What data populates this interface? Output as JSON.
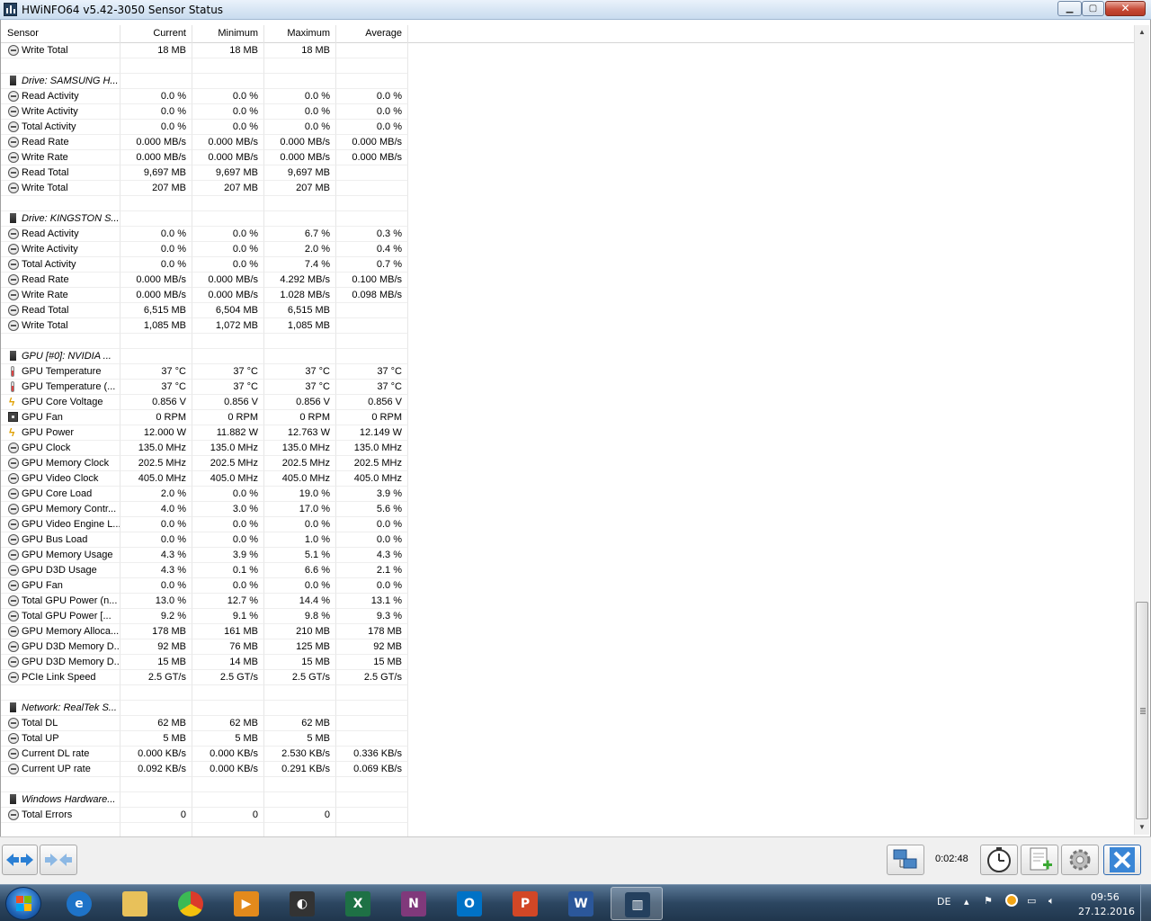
{
  "window": {
    "title": "HWiNFO64 v5.42-3050 Sensor Status",
    "controls": {
      "minimize": "▁",
      "maximize": "▢",
      "close": "✕"
    }
  },
  "table": {
    "headers": [
      "Sensor",
      "Current",
      "Minimum",
      "Maximum",
      "Average"
    ],
    "rows": [
      {
        "type": "item",
        "icon": "clock",
        "name": "Write Total",
        "current": "18 MB",
        "min": "18 MB",
        "max": "18 MB",
        "avg": ""
      },
      {
        "type": "blank"
      },
      {
        "type": "group",
        "icon": "drive",
        "name": "Drive: SAMSUNG H..."
      },
      {
        "type": "item",
        "icon": "clock",
        "name": "Read Activity",
        "current": "0.0 %",
        "min": "0.0 %",
        "max": "0.0 %",
        "avg": "0.0 %"
      },
      {
        "type": "item",
        "icon": "clock",
        "name": "Write Activity",
        "current": "0.0 %",
        "min": "0.0 %",
        "max": "0.0 %",
        "avg": "0.0 %"
      },
      {
        "type": "item",
        "icon": "clock",
        "name": "Total Activity",
        "current": "0.0 %",
        "min": "0.0 %",
        "max": "0.0 %",
        "avg": "0.0 %"
      },
      {
        "type": "item",
        "icon": "clock",
        "name": "Read Rate",
        "current": "0.000 MB/s",
        "min": "0.000 MB/s",
        "max": "0.000 MB/s",
        "avg": "0.000 MB/s"
      },
      {
        "type": "item",
        "icon": "clock",
        "name": "Write Rate",
        "current": "0.000 MB/s",
        "min": "0.000 MB/s",
        "max": "0.000 MB/s",
        "avg": "0.000 MB/s"
      },
      {
        "type": "item",
        "icon": "clock",
        "name": "Read Total",
        "current": "9,697 MB",
        "min": "9,697 MB",
        "max": "9,697 MB",
        "avg": ""
      },
      {
        "type": "item",
        "icon": "clock",
        "name": "Write Total",
        "current": "207 MB",
        "min": "207 MB",
        "max": "207 MB",
        "avg": ""
      },
      {
        "type": "blank"
      },
      {
        "type": "group",
        "icon": "drive",
        "name": "Drive: KINGSTON S..."
      },
      {
        "type": "item",
        "icon": "clock",
        "name": "Read Activity",
        "current": "0.0 %",
        "min": "0.0 %",
        "max": "6.7 %",
        "avg": "0.3 %"
      },
      {
        "type": "item",
        "icon": "clock",
        "name": "Write Activity",
        "current": "0.0 %",
        "min": "0.0 %",
        "max": "2.0 %",
        "avg": "0.4 %"
      },
      {
        "type": "item",
        "icon": "clock",
        "name": "Total Activity",
        "current": "0.0 %",
        "min": "0.0 %",
        "max": "7.4 %",
        "avg": "0.7 %"
      },
      {
        "type": "item",
        "icon": "clock",
        "name": "Read Rate",
        "current": "0.000 MB/s",
        "min": "0.000 MB/s",
        "max": "4.292 MB/s",
        "avg": "0.100 MB/s"
      },
      {
        "type": "item",
        "icon": "clock",
        "name": "Write Rate",
        "current": "0.000 MB/s",
        "min": "0.000 MB/s",
        "max": "1.028 MB/s",
        "avg": "0.098 MB/s"
      },
      {
        "type": "item",
        "icon": "clock",
        "name": "Read Total",
        "current": "6,515 MB",
        "min": "6,504 MB",
        "max": "6,515 MB",
        "avg": ""
      },
      {
        "type": "item",
        "icon": "clock",
        "name": "Write Total",
        "current": "1,085 MB",
        "min": "1,072 MB",
        "max": "1,085 MB",
        "avg": ""
      },
      {
        "type": "blank"
      },
      {
        "type": "group",
        "icon": "drive",
        "name": "GPU [#0]: NVIDIA ..."
      },
      {
        "type": "item",
        "icon": "therm",
        "name": "GPU Temperature",
        "current": "37 °C",
        "min": "37 °C",
        "max": "37 °C",
        "avg": "37 °C"
      },
      {
        "type": "item",
        "icon": "therm",
        "name": "GPU Temperature (...",
        "current": "37 °C",
        "min": "37 °C",
        "max": "37 °C",
        "avg": "37 °C"
      },
      {
        "type": "item",
        "icon": "bolt",
        "name": "GPU Core Voltage",
        "current": "0.856 V",
        "min": "0.856 V",
        "max": "0.856 V",
        "avg": "0.856 V"
      },
      {
        "type": "item",
        "icon": "fan",
        "name": "GPU Fan",
        "current": "0 RPM",
        "min": "0 RPM",
        "max": "0 RPM",
        "avg": "0 RPM"
      },
      {
        "type": "item",
        "icon": "bolt",
        "name": "GPU Power",
        "current": "12.000 W",
        "min": "11.882 W",
        "max": "12.763 W",
        "avg": "12.149 W"
      },
      {
        "type": "item",
        "icon": "clock",
        "name": "GPU Clock",
        "current": "135.0 MHz",
        "min": "135.0 MHz",
        "max": "135.0 MHz",
        "avg": "135.0 MHz"
      },
      {
        "type": "item",
        "icon": "clock",
        "name": "GPU Memory Clock",
        "current": "202.5 MHz",
        "min": "202.5 MHz",
        "max": "202.5 MHz",
        "avg": "202.5 MHz"
      },
      {
        "type": "item",
        "icon": "clock",
        "name": "GPU Video Clock",
        "current": "405.0 MHz",
        "min": "405.0 MHz",
        "max": "405.0 MHz",
        "avg": "405.0 MHz"
      },
      {
        "type": "item",
        "icon": "clock",
        "name": "GPU Core Load",
        "current": "2.0 %",
        "min": "0.0 %",
        "max": "19.0 %",
        "avg": "3.9 %"
      },
      {
        "type": "item",
        "icon": "clock",
        "name": "GPU Memory Contr...",
        "current": "4.0 %",
        "min": "3.0 %",
        "max": "17.0 %",
        "avg": "5.6 %"
      },
      {
        "type": "item",
        "icon": "clock",
        "name": "GPU Video Engine L...",
        "current": "0.0 %",
        "min": "0.0 %",
        "max": "0.0 %",
        "avg": "0.0 %"
      },
      {
        "type": "item",
        "icon": "clock",
        "name": "GPU Bus Load",
        "current": "0.0 %",
        "min": "0.0 %",
        "max": "1.0 %",
        "avg": "0.0 %"
      },
      {
        "type": "item",
        "icon": "clock",
        "name": "GPU Memory Usage",
        "current": "4.3 %",
        "min": "3.9 %",
        "max": "5.1 %",
        "avg": "4.3 %"
      },
      {
        "type": "item",
        "icon": "clock",
        "name": "GPU D3D Usage",
        "current": "4.3 %",
        "min": "0.1 %",
        "max": "6.6 %",
        "avg": "2.1 %"
      },
      {
        "type": "item",
        "icon": "clock",
        "name": "GPU Fan",
        "current": "0.0 %",
        "min": "0.0 %",
        "max": "0.0 %",
        "avg": "0.0 %"
      },
      {
        "type": "item",
        "icon": "clock",
        "name": "Total GPU Power (n...",
        "current": "13.0 %",
        "min": "12.7 %",
        "max": "14.4 %",
        "avg": "13.1 %"
      },
      {
        "type": "item",
        "icon": "clock",
        "name": "Total GPU Power [...",
        "current": "9.2 %",
        "min": "9.1 %",
        "max": "9.8 %",
        "avg": "9.3 %"
      },
      {
        "type": "item",
        "icon": "clock",
        "name": "GPU Memory Alloca...",
        "current": "178 MB",
        "min": "161 MB",
        "max": "210 MB",
        "avg": "178 MB"
      },
      {
        "type": "item",
        "icon": "clock",
        "name": "GPU D3D Memory D...",
        "current": "92 MB",
        "min": "76 MB",
        "max": "125 MB",
        "avg": "92 MB"
      },
      {
        "type": "item",
        "icon": "clock",
        "name": "GPU D3D Memory D...",
        "current": "15 MB",
        "min": "14 MB",
        "max": "15 MB",
        "avg": "15 MB"
      },
      {
        "type": "item",
        "icon": "clock",
        "name": "PCIe Link Speed",
        "current": "2.5 GT/s",
        "min": "2.5 GT/s",
        "max": "2.5 GT/s",
        "avg": "2.5 GT/s"
      },
      {
        "type": "blank"
      },
      {
        "type": "group",
        "icon": "drive",
        "name": "Network: RealTek S..."
      },
      {
        "type": "item",
        "icon": "clock",
        "name": "Total DL",
        "current": "62 MB",
        "min": "62 MB",
        "max": "62 MB",
        "avg": ""
      },
      {
        "type": "item",
        "icon": "clock",
        "name": "Total UP",
        "current": "5 MB",
        "min": "5 MB",
        "max": "5 MB",
        "avg": ""
      },
      {
        "type": "item",
        "icon": "clock",
        "name": "Current DL rate",
        "current": "0.000 KB/s",
        "min": "0.000 KB/s",
        "max": "2.530 KB/s",
        "avg": "0.336 KB/s"
      },
      {
        "type": "item",
        "icon": "clock",
        "name": "Current UP rate",
        "current": "0.092 KB/s",
        "min": "0.000 KB/s",
        "max": "0.291 KB/s",
        "avg": "0.069 KB/s"
      },
      {
        "type": "blank"
      },
      {
        "type": "group",
        "icon": "drive",
        "name": "Windows Hardware..."
      },
      {
        "type": "item",
        "icon": "clock",
        "name": "Total Errors",
        "current": "0",
        "min": "0",
        "max": "0",
        "avg": ""
      },
      {
        "type": "blank"
      }
    ]
  },
  "scrollbar": {
    "up": "▲",
    "down": "▼"
  },
  "toolbar": {
    "elapsed": "0:02:48",
    "icons": [
      "arrows-left-right-icon",
      "arrows-compact-icon",
      "network-computers-icon",
      "stopwatch-icon",
      "report-add-icon",
      "gear-icon",
      "close-x-icon"
    ]
  },
  "taskbar": {
    "apps": [
      {
        "name": "internet-explorer",
        "label": "e",
        "color": "#1e73c8"
      },
      {
        "name": "file-explorer",
        "label": "",
        "color": "#e8c15a"
      },
      {
        "name": "chrome",
        "label": "",
        "color": "#db3b2b"
      },
      {
        "name": "media-player",
        "label": "▶",
        "color": "#e38a1c"
      },
      {
        "name": "app-dark",
        "label": "◐",
        "color": "#333333"
      },
      {
        "name": "excel",
        "label": "X",
        "color": "#1e7145"
      },
      {
        "name": "onenote",
        "label": "N",
        "color": "#80397b"
      },
      {
        "name": "outlook",
        "label": "O",
        "color": "#0072c6"
      },
      {
        "name": "powerpoint",
        "label": "P",
        "color": "#d24726"
      },
      {
        "name": "word",
        "label": "W",
        "color": "#2b579a"
      },
      {
        "name": "hwinfo",
        "label": "▥",
        "color": "#24405e",
        "active": true
      }
    ],
    "language": "DE",
    "time": "09:56",
    "date": "27.12.2016"
  }
}
